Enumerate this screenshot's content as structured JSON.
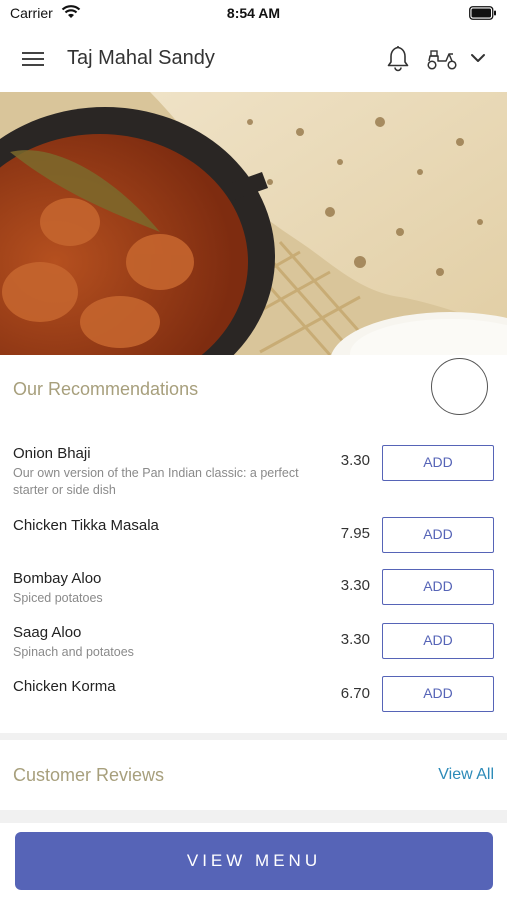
{
  "status_bar": {
    "carrier": "Carrier",
    "time": "8:54 AM"
  },
  "header": {
    "title": "Taj Mahal Sandy",
    "icons": [
      "menu-icon",
      "bell-icon",
      "scooter-icon",
      "chevron-down-icon"
    ]
  },
  "recommendations": {
    "title": "Our Recommendations",
    "items": [
      {
        "name": "Onion Bhaji",
        "description": "Our own version of the Pan Indian classic: a perfect starter or side dish",
        "price": "3.30",
        "button": "ADD"
      },
      {
        "name": "Chicken Tikka Masala",
        "description": "",
        "price": "7.95",
        "button": "ADD"
      },
      {
        "name": "Bombay Aloo",
        "description": "Spiced potatoes",
        "price": "3.30",
        "button": "ADD"
      },
      {
        "name": "Saag Aloo",
        "description": "Spinach and potatoes",
        "price": "3.30",
        "button": "ADD"
      },
      {
        "name": "Chicken Korma",
        "description": "",
        "price": "6.70",
        "button": "ADD"
      }
    ]
  },
  "reviews": {
    "title": "Customer Reviews",
    "view_all": "View All"
  },
  "bottom": {
    "view_menu": "VIEW MENU"
  },
  "colors": {
    "accent": "#5664b7",
    "section_title": "#a79f7c",
    "link": "#2c8ab8"
  }
}
